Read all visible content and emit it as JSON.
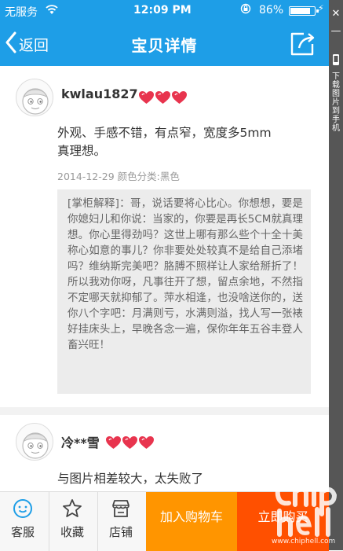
{
  "status_bar": {
    "carrier": "无服务",
    "time": "12:09 PM",
    "battery_percent": "86%",
    "battery_level": 0.86
  },
  "nav": {
    "back_label": "返回",
    "title": "宝贝详情"
  },
  "side_panel": {
    "label": "下载图片到手机"
  },
  "reviews": [
    {
      "username": "kwlau1827",
      "hearts": 3,
      "text_lines": [
        "外观、手感不错，有点窄，宽度多5mm",
        "真理想。"
      ],
      "date": "2014-12-29",
      "variant": "颜色分类:黑色",
      "reply_text": "[掌柜解释]：哥，说话要将心比心。你想想，要是你媳妇儿和你说：当家的，你要是再长5CM就真理想。你心里得劲吗？这世上哪有那么些个十全十美称心如意的事儿？你非要处处较真不是给自己添堵吗？维纳斯完美吧？胳膊不照样让人家给掰折了！所以我劝你呀，凡事往开了想，留点余地，不然指不定哪天就抑郁了。萍水相逢，也没啥送你的，送你八个字吧：月满则亏，水满则溢，找人写一张裱好挂床头上，早晚各念一遍，保你年年五谷丰登人畜兴旺！"
    },
    {
      "username": "冷**雪",
      "hearts": 3,
      "text_lines": [
        "与图片相差较大，太失败了"
      ]
    }
  ],
  "bottom_bar": {
    "service_label": "客服",
    "favorite_label": "收藏",
    "shop_label": "店铺",
    "cart_label": "加入购物车",
    "buy_label": "立即购买"
  },
  "watermark": {
    "url": "www.chiphell.com"
  },
  "colors": {
    "header_blue": "#1e9ee7",
    "heart_red": "#e8344e",
    "cart_orange": "#ff9500",
    "buy_orange": "#ff5000"
  }
}
